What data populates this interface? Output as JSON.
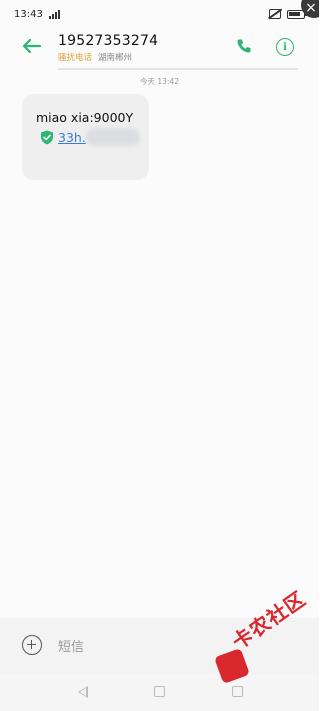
{
  "status_bar": {
    "time": "13:43"
  },
  "header": {
    "phone_number": "19527353274",
    "tag": "骚扰电话",
    "location": "湖南郴州"
  },
  "conversation": {
    "timestamp": "今天 13:42",
    "messages": [
      {
        "text": "miao xia:9000Y",
        "link": "33h.",
        "verified": true
      }
    ]
  },
  "composer": {
    "placeholder": "短信"
  },
  "watermark": {
    "text": "卡农社区"
  },
  "colors": {
    "accent": "#2bb673",
    "tag": "#e2a23a",
    "link": "#3b7be0",
    "bubble": "#efefef"
  }
}
